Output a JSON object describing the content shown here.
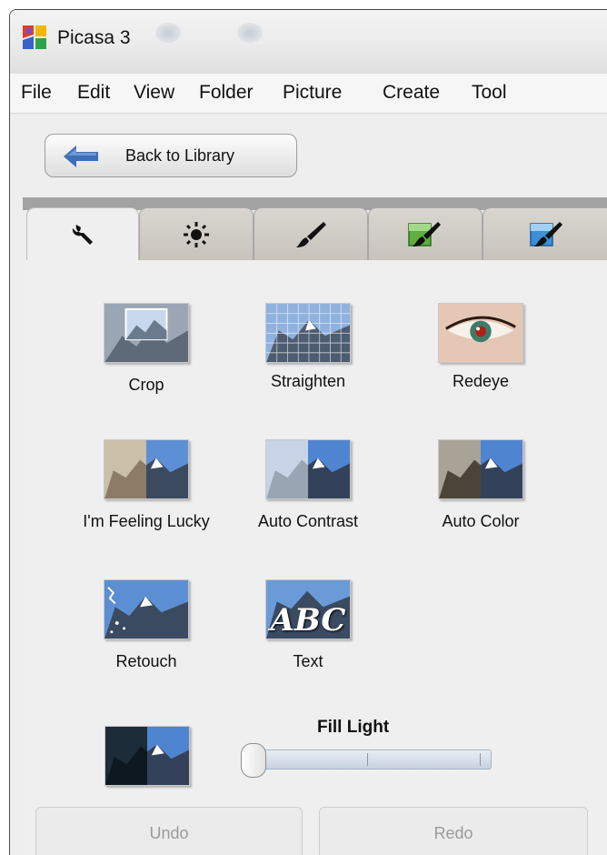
{
  "window": {
    "title": "Picasa 3"
  },
  "menu": {
    "items": [
      "File",
      "Edit",
      "View",
      "Folder",
      "Picture",
      "Create",
      "Tool"
    ]
  },
  "back_button": {
    "label": "Back to Library",
    "icon": "back-arrow-icon"
  },
  "tabs": [
    {
      "icon": "wrench-icon",
      "active": true
    },
    {
      "icon": "sun-icon",
      "active": false
    },
    {
      "icon": "brush-icon",
      "active": false
    },
    {
      "icon": "green-brush-icon",
      "active": false
    },
    {
      "icon": "blue-brush-icon",
      "active": false
    }
  ],
  "tools": [
    {
      "label": "Crop",
      "icon": "crop-thumbnail"
    },
    {
      "label": "Straighten",
      "icon": "straighten-thumbnail"
    },
    {
      "label": "Redeye",
      "icon": "redeye-thumbnail"
    },
    {
      "label": "I'm Feeling Lucky",
      "icon": "feeling-lucky-thumbnail"
    },
    {
      "label": "Auto Contrast",
      "icon": "auto-contrast-thumbnail"
    },
    {
      "label": "Auto Color",
      "icon": "auto-color-thumbnail"
    },
    {
      "label": "Retouch",
      "icon": "retouch-thumbnail"
    },
    {
      "label": "Text",
      "icon": "text-thumbnail",
      "overlay": "ABC"
    }
  ],
  "fill_light": {
    "label": "Fill Light",
    "value": 0.0
  },
  "footer": {
    "undo": "Undo",
    "redo": "Redo"
  },
  "colors": {
    "tab_band": "#a2a2a2",
    "back_arrow": "#3f6fb6",
    "disabled_text": "#9a9a9a"
  }
}
